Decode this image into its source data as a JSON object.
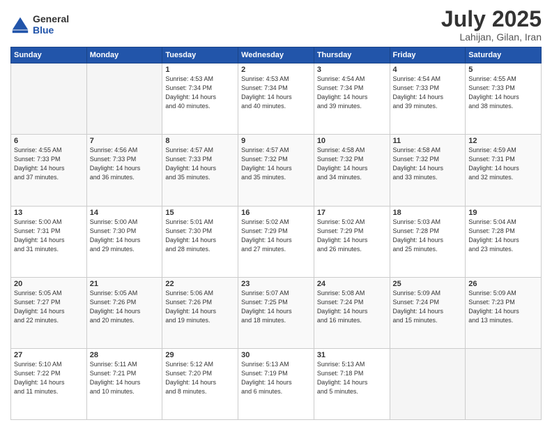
{
  "logo": {
    "general": "General",
    "blue": "Blue"
  },
  "title": {
    "month": "July 2025",
    "location": "Lahijan, Gilan, Iran"
  },
  "weekdays": [
    "Sunday",
    "Monday",
    "Tuesday",
    "Wednesday",
    "Thursday",
    "Friday",
    "Saturday"
  ],
  "weeks": [
    [
      {
        "day": "",
        "info": ""
      },
      {
        "day": "",
        "info": ""
      },
      {
        "day": "1",
        "info": "Sunrise: 4:53 AM\nSunset: 7:34 PM\nDaylight: 14 hours\nand 40 minutes."
      },
      {
        "day": "2",
        "info": "Sunrise: 4:53 AM\nSunset: 7:34 PM\nDaylight: 14 hours\nand 40 minutes."
      },
      {
        "day": "3",
        "info": "Sunrise: 4:54 AM\nSunset: 7:34 PM\nDaylight: 14 hours\nand 39 minutes."
      },
      {
        "day": "4",
        "info": "Sunrise: 4:54 AM\nSunset: 7:33 PM\nDaylight: 14 hours\nand 39 minutes."
      },
      {
        "day": "5",
        "info": "Sunrise: 4:55 AM\nSunset: 7:33 PM\nDaylight: 14 hours\nand 38 minutes."
      }
    ],
    [
      {
        "day": "6",
        "info": "Sunrise: 4:55 AM\nSunset: 7:33 PM\nDaylight: 14 hours\nand 37 minutes."
      },
      {
        "day": "7",
        "info": "Sunrise: 4:56 AM\nSunset: 7:33 PM\nDaylight: 14 hours\nand 36 minutes."
      },
      {
        "day": "8",
        "info": "Sunrise: 4:57 AM\nSunset: 7:33 PM\nDaylight: 14 hours\nand 35 minutes."
      },
      {
        "day": "9",
        "info": "Sunrise: 4:57 AM\nSunset: 7:32 PM\nDaylight: 14 hours\nand 35 minutes."
      },
      {
        "day": "10",
        "info": "Sunrise: 4:58 AM\nSunset: 7:32 PM\nDaylight: 14 hours\nand 34 minutes."
      },
      {
        "day": "11",
        "info": "Sunrise: 4:58 AM\nSunset: 7:32 PM\nDaylight: 14 hours\nand 33 minutes."
      },
      {
        "day": "12",
        "info": "Sunrise: 4:59 AM\nSunset: 7:31 PM\nDaylight: 14 hours\nand 32 minutes."
      }
    ],
    [
      {
        "day": "13",
        "info": "Sunrise: 5:00 AM\nSunset: 7:31 PM\nDaylight: 14 hours\nand 31 minutes."
      },
      {
        "day": "14",
        "info": "Sunrise: 5:00 AM\nSunset: 7:30 PM\nDaylight: 14 hours\nand 29 minutes."
      },
      {
        "day": "15",
        "info": "Sunrise: 5:01 AM\nSunset: 7:30 PM\nDaylight: 14 hours\nand 28 minutes."
      },
      {
        "day": "16",
        "info": "Sunrise: 5:02 AM\nSunset: 7:29 PM\nDaylight: 14 hours\nand 27 minutes."
      },
      {
        "day": "17",
        "info": "Sunrise: 5:02 AM\nSunset: 7:29 PM\nDaylight: 14 hours\nand 26 minutes."
      },
      {
        "day": "18",
        "info": "Sunrise: 5:03 AM\nSunset: 7:28 PM\nDaylight: 14 hours\nand 25 minutes."
      },
      {
        "day": "19",
        "info": "Sunrise: 5:04 AM\nSunset: 7:28 PM\nDaylight: 14 hours\nand 23 minutes."
      }
    ],
    [
      {
        "day": "20",
        "info": "Sunrise: 5:05 AM\nSunset: 7:27 PM\nDaylight: 14 hours\nand 22 minutes."
      },
      {
        "day": "21",
        "info": "Sunrise: 5:05 AM\nSunset: 7:26 PM\nDaylight: 14 hours\nand 20 minutes."
      },
      {
        "day": "22",
        "info": "Sunrise: 5:06 AM\nSunset: 7:26 PM\nDaylight: 14 hours\nand 19 minutes."
      },
      {
        "day": "23",
        "info": "Sunrise: 5:07 AM\nSunset: 7:25 PM\nDaylight: 14 hours\nand 18 minutes."
      },
      {
        "day": "24",
        "info": "Sunrise: 5:08 AM\nSunset: 7:24 PM\nDaylight: 14 hours\nand 16 minutes."
      },
      {
        "day": "25",
        "info": "Sunrise: 5:09 AM\nSunset: 7:24 PM\nDaylight: 14 hours\nand 15 minutes."
      },
      {
        "day": "26",
        "info": "Sunrise: 5:09 AM\nSunset: 7:23 PM\nDaylight: 14 hours\nand 13 minutes."
      }
    ],
    [
      {
        "day": "27",
        "info": "Sunrise: 5:10 AM\nSunset: 7:22 PM\nDaylight: 14 hours\nand 11 minutes."
      },
      {
        "day": "28",
        "info": "Sunrise: 5:11 AM\nSunset: 7:21 PM\nDaylight: 14 hours\nand 10 minutes."
      },
      {
        "day": "29",
        "info": "Sunrise: 5:12 AM\nSunset: 7:20 PM\nDaylight: 14 hours\nand 8 minutes."
      },
      {
        "day": "30",
        "info": "Sunrise: 5:13 AM\nSunset: 7:19 PM\nDaylight: 14 hours\nand 6 minutes."
      },
      {
        "day": "31",
        "info": "Sunrise: 5:13 AM\nSunset: 7:18 PM\nDaylight: 14 hours\nand 5 minutes."
      },
      {
        "day": "",
        "info": ""
      },
      {
        "day": "",
        "info": ""
      }
    ]
  ]
}
